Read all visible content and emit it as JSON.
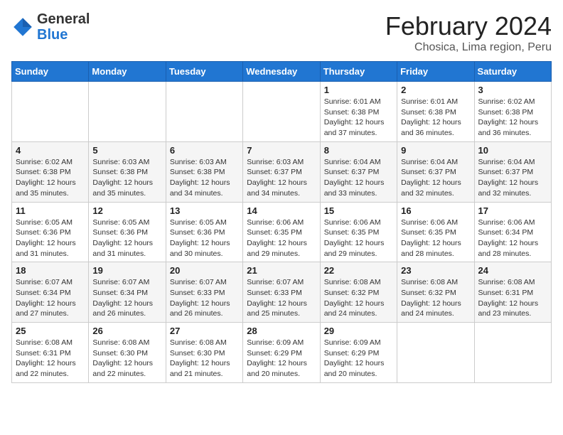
{
  "logo": {
    "general": "General",
    "blue": "Blue"
  },
  "header": {
    "month": "February 2024",
    "location": "Chosica, Lima region, Peru"
  },
  "weekdays": [
    "Sunday",
    "Monday",
    "Tuesday",
    "Wednesday",
    "Thursday",
    "Friday",
    "Saturday"
  ],
  "weeks": [
    [
      {
        "day": "",
        "info": ""
      },
      {
        "day": "",
        "info": ""
      },
      {
        "day": "",
        "info": ""
      },
      {
        "day": "",
        "info": ""
      },
      {
        "day": "1",
        "info": "Sunrise: 6:01 AM\nSunset: 6:38 PM\nDaylight: 12 hours and 37 minutes."
      },
      {
        "day": "2",
        "info": "Sunrise: 6:01 AM\nSunset: 6:38 PM\nDaylight: 12 hours and 36 minutes."
      },
      {
        "day": "3",
        "info": "Sunrise: 6:02 AM\nSunset: 6:38 PM\nDaylight: 12 hours and 36 minutes."
      }
    ],
    [
      {
        "day": "4",
        "info": "Sunrise: 6:02 AM\nSunset: 6:38 PM\nDaylight: 12 hours and 35 minutes."
      },
      {
        "day": "5",
        "info": "Sunrise: 6:03 AM\nSunset: 6:38 PM\nDaylight: 12 hours and 35 minutes."
      },
      {
        "day": "6",
        "info": "Sunrise: 6:03 AM\nSunset: 6:38 PM\nDaylight: 12 hours and 34 minutes."
      },
      {
        "day": "7",
        "info": "Sunrise: 6:03 AM\nSunset: 6:37 PM\nDaylight: 12 hours and 34 minutes."
      },
      {
        "day": "8",
        "info": "Sunrise: 6:04 AM\nSunset: 6:37 PM\nDaylight: 12 hours and 33 minutes."
      },
      {
        "day": "9",
        "info": "Sunrise: 6:04 AM\nSunset: 6:37 PM\nDaylight: 12 hours and 32 minutes."
      },
      {
        "day": "10",
        "info": "Sunrise: 6:04 AM\nSunset: 6:37 PM\nDaylight: 12 hours and 32 minutes."
      }
    ],
    [
      {
        "day": "11",
        "info": "Sunrise: 6:05 AM\nSunset: 6:36 PM\nDaylight: 12 hours and 31 minutes."
      },
      {
        "day": "12",
        "info": "Sunrise: 6:05 AM\nSunset: 6:36 PM\nDaylight: 12 hours and 31 minutes."
      },
      {
        "day": "13",
        "info": "Sunrise: 6:05 AM\nSunset: 6:36 PM\nDaylight: 12 hours and 30 minutes."
      },
      {
        "day": "14",
        "info": "Sunrise: 6:06 AM\nSunset: 6:35 PM\nDaylight: 12 hours and 29 minutes."
      },
      {
        "day": "15",
        "info": "Sunrise: 6:06 AM\nSunset: 6:35 PM\nDaylight: 12 hours and 29 minutes."
      },
      {
        "day": "16",
        "info": "Sunrise: 6:06 AM\nSunset: 6:35 PM\nDaylight: 12 hours and 28 minutes."
      },
      {
        "day": "17",
        "info": "Sunrise: 6:06 AM\nSunset: 6:34 PM\nDaylight: 12 hours and 28 minutes."
      }
    ],
    [
      {
        "day": "18",
        "info": "Sunrise: 6:07 AM\nSunset: 6:34 PM\nDaylight: 12 hours and 27 minutes."
      },
      {
        "day": "19",
        "info": "Sunrise: 6:07 AM\nSunset: 6:34 PM\nDaylight: 12 hours and 26 minutes."
      },
      {
        "day": "20",
        "info": "Sunrise: 6:07 AM\nSunset: 6:33 PM\nDaylight: 12 hours and 26 minutes."
      },
      {
        "day": "21",
        "info": "Sunrise: 6:07 AM\nSunset: 6:33 PM\nDaylight: 12 hours and 25 minutes."
      },
      {
        "day": "22",
        "info": "Sunrise: 6:08 AM\nSunset: 6:32 PM\nDaylight: 12 hours and 24 minutes."
      },
      {
        "day": "23",
        "info": "Sunrise: 6:08 AM\nSunset: 6:32 PM\nDaylight: 12 hours and 24 minutes."
      },
      {
        "day": "24",
        "info": "Sunrise: 6:08 AM\nSunset: 6:31 PM\nDaylight: 12 hours and 23 minutes."
      }
    ],
    [
      {
        "day": "25",
        "info": "Sunrise: 6:08 AM\nSunset: 6:31 PM\nDaylight: 12 hours and 22 minutes."
      },
      {
        "day": "26",
        "info": "Sunrise: 6:08 AM\nSunset: 6:30 PM\nDaylight: 12 hours and 22 minutes."
      },
      {
        "day": "27",
        "info": "Sunrise: 6:08 AM\nSunset: 6:30 PM\nDaylight: 12 hours and 21 minutes."
      },
      {
        "day": "28",
        "info": "Sunrise: 6:09 AM\nSunset: 6:29 PM\nDaylight: 12 hours and 20 minutes."
      },
      {
        "day": "29",
        "info": "Sunrise: 6:09 AM\nSunset: 6:29 PM\nDaylight: 12 hours and 20 minutes."
      },
      {
        "day": "",
        "info": ""
      },
      {
        "day": "",
        "info": ""
      }
    ]
  ]
}
